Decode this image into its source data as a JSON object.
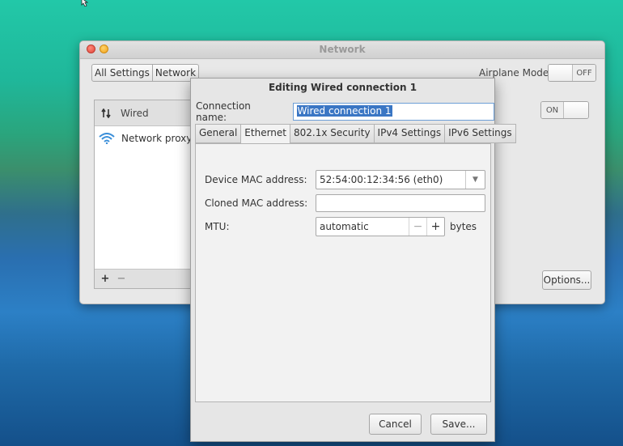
{
  "window": {
    "title": "Network",
    "nav_buttons": [
      "All Settings",
      "Network"
    ],
    "airplane_mode": {
      "label": "Airplane Mode",
      "state": "OFF"
    },
    "list": {
      "header": "Wired",
      "items": [
        "Network proxy"
      ]
    },
    "wired_toggle_state": "ON",
    "options_label": "Options..."
  },
  "dialog": {
    "title": "Editing Wired connection 1",
    "connection_name_label": "Connection name:",
    "connection_name_value": "Wired connection 1",
    "tabs": [
      "General",
      "Ethernet",
      "802.1x Security",
      "IPv4 Settings",
      "IPv6 Settings"
    ],
    "active_tab": "Ethernet",
    "fields": {
      "device_mac_label": "Device MAC address:",
      "device_mac_value": "52:54:00:12:34:56 (eth0)",
      "cloned_mac_label": "Cloned MAC address:",
      "cloned_mac_value": "",
      "mtu_label": "MTU:",
      "mtu_value": "automatic",
      "mtu_unit": "bytes"
    },
    "buttons": {
      "cancel": "Cancel",
      "save": "Save..."
    }
  }
}
